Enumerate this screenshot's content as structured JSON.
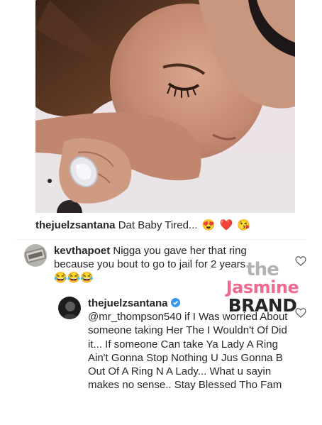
{
  "post": {
    "caption_username": "thejuelzsantana",
    "caption_text": "Dat Baby Tired...",
    "caption_emojis": [
      "😍",
      "❤️",
      "😘"
    ]
  },
  "comments": [
    {
      "username": "kevthapoet",
      "text": "Nigga you gave her that ring because you bout to go to jail for 2 years",
      "emojis": "😂😂😂",
      "liked": false
    },
    {
      "username": "thejuelzsantana",
      "verified": true,
      "mention": "@mr_thompson540",
      "text": "if I Was worried About someone taking Her The I Wouldn't Of Did it... If someone Can take Ya Lady A Ring Ain't Gonna Stop Nothing U Jus Gonna B Out Of A Ring N A Lady... What u sayin makes no sense.. Stay Blessed Tho Fam",
      "liked": false
    }
  ],
  "watermark": {
    "line1": "the",
    "line2": "Jasmine",
    "line3": "BRAND"
  },
  "icons": {
    "like": "heart-outline-icon",
    "verified": "verified-badge-icon"
  },
  "colors": {
    "text": "#262626",
    "verified": "#3897f0",
    "watermark_pink": "#f06a8f"
  }
}
